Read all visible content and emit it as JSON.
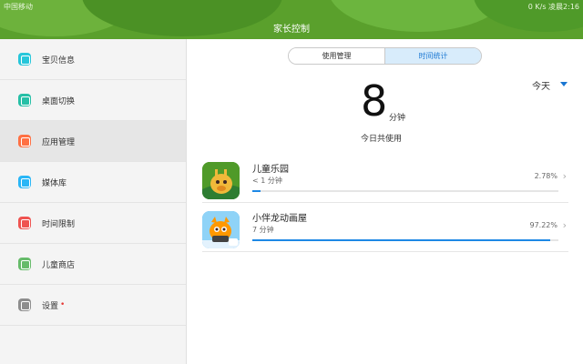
{
  "status_bar": {
    "carrier": "中国移动",
    "right": "0 K/s  凌晨2:16"
  },
  "header": {
    "title": "家长控制"
  },
  "sidebar": {
    "items": [
      {
        "label": "宝贝信息",
        "icon": "baby-info-icon",
        "color": "#26c6da"
      },
      {
        "label": "桌面切换",
        "icon": "desktop-switch-icon",
        "color": "#26bfa6"
      },
      {
        "label": "应用管理",
        "icon": "app-manage-icon",
        "color": "#ff7043"
      },
      {
        "label": "媒体库",
        "icon": "media-library-icon",
        "color": "#29b6f6"
      },
      {
        "label": "时间限制",
        "icon": "time-limit-icon",
        "color": "#ef5350"
      },
      {
        "label": "儿童商店",
        "icon": "kids-store-icon",
        "color": "#66bb6a"
      },
      {
        "label": "设置",
        "icon": "settings-icon",
        "color": "#8d8d8d",
        "dot": "•"
      }
    ],
    "active_index": 2
  },
  "tabs": {
    "usage_management": "使用管理",
    "time_stats": "时间统计",
    "active": "time_stats"
  },
  "period": {
    "selected": "今天"
  },
  "usage": {
    "value": "8",
    "unit": "分钟",
    "caption": "今日共使用"
  },
  "apps": [
    {
      "name": "儿童乐园",
      "time": "< 1 分钟",
      "percent": "2.78%",
      "fraction": 0.0278,
      "icon": "kids-park-app-icon"
    },
    {
      "name": "小伴龙动画屋",
      "time": "7 分钟",
      "percent": "97.22%",
      "fraction": 0.9722,
      "icon": "dragon-cartoon-app-icon"
    }
  ],
  "colors": {
    "header": "#5aa02c",
    "accent": "#1976d2",
    "bar": "#1e88e5"
  }
}
